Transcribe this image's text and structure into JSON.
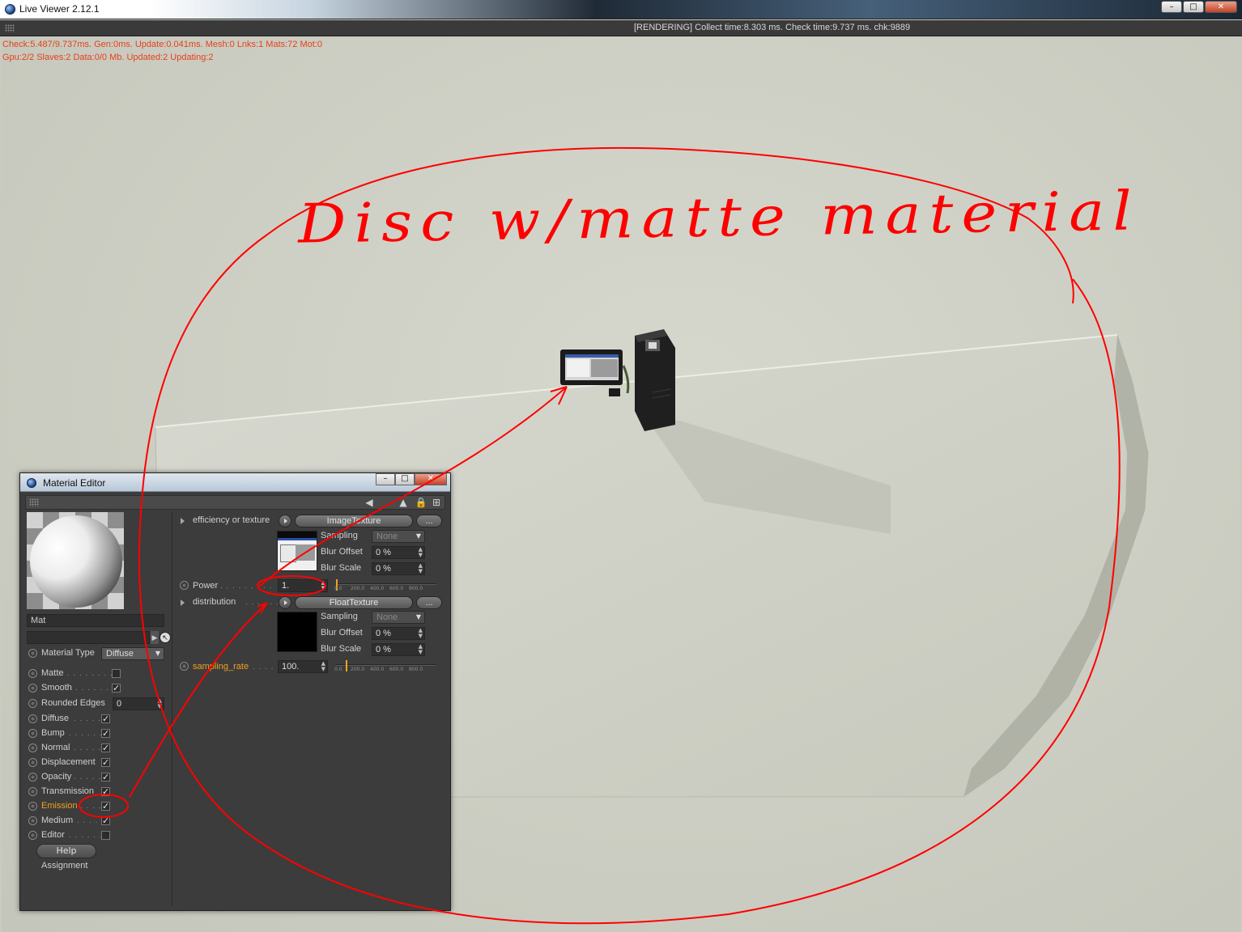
{
  "app": {
    "title": "Live Viewer 2.12.1",
    "window_controls": [
      "–",
      "□",
      "✕"
    ],
    "status_text": "[RENDERING] Collect time:8.303 ms.  Check time:9.737 ms.  chk:9889",
    "stats_line1": "Check:5.487/9.737ms. Gen:0ms. Update:0.041ms. Mesh:0 Lnks:1 Mats:72 Mot:0",
    "stats_line2": "Gpu:2/2 Slaves:2  Data:0/0 Mb.   Updated:2 Updating:2"
  },
  "annotation": {
    "text": "Disc w/matte material",
    "color": "#ff0000"
  },
  "material_editor": {
    "title": "Material Editor",
    "window_controls": [
      "–",
      "□",
      "✕"
    ],
    "toolbar_icons": [
      "arrow-left-icon",
      "arrow-up-icon",
      "lock-icon",
      "plus-icon"
    ],
    "name": "Mat",
    "link_value": "",
    "material_type_label": "Material Type",
    "material_type_value": "Diffuse",
    "channels": [
      {
        "label": "Matte",
        "dots": ". . . . . . . . .",
        "checked": false
      },
      {
        "label": "Smooth",
        "dots": ". . . . . . .",
        "checked": true
      },
      {
        "label": "Rounded Edges",
        "dots": "",
        "value": "0"
      },
      {
        "label": "Diffuse",
        "dots": ". . . . . .",
        "checked": true
      },
      {
        "label": "Bump",
        "dots": ". . . . . . .",
        "checked": true
      },
      {
        "label": "Normal",
        "dots": ". . . . .",
        "checked": true
      },
      {
        "label": "Displacement",
        "dots": "",
        "checked": true
      },
      {
        "label": "Opacity",
        "dots": ". . . . .",
        "checked": true
      },
      {
        "label": "Transmission",
        "dots": "",
        "checked": true
      },
      {
        "label": "Emission",
        "dots": ". . . .",
        "checked": true,
        "active": true
      },
      {
        "label": "Medium",
        "dots": ". . . .",
        "checked": true
      },
      {
        "label": "Editor",
        "dots": ". . . . . .",
        "checked": false
      }
    ],
    "help_label": "Help",
    "assignment_label": "Assignment",
    "params": {
      "efficiency_label": "efficiency or texture",
      "efficiency_button": "ImageTexture",
      "more_button": "...",
      "sampling_label": "Sampling",
      "sampling_value": "None",
      "blur_offset_label": "Blur Offset",
      "blur_offset_value": "0 %",
      "blur_scale_label": "Blur Scale",
      "blur_scale_value": "0 %",
      "power_label": "Power",
      "power_dots": ". . . . . . . . .",
      "power_value": "1.",
      "distribution_label": "distribution",
      "distribution_dots": ". . . . . .",
      "distribution_button": "FloatTexture",
      "sampling2_label": "Sampling",
      "sampling2_value": "None",
      "blur_offset2_label": "Blur Offset",
      "blur_offset2_value": "0 %",
      "blur_scale2_label": "Blur Scale",
      "blur_scale2_value": "0 %",
      "sampling_rate_label": "sampling_rate",
      "sampling_rate_dots": ". . . . .",
      "sampling_rate_value": "100.",
      "slider_ticks": [
        "0.0",
        "200.0",
        "400.0",
        "600.0",
        "800.0"
      ],
      "power_slider_fraction": 0.0,
      "sampling_rate_slider_fraction": 0.1
    }
  },
  "colors": {
    "accent_orange": "#f0a21e",
    "stats_red": "#e8401a",
    "annotation_red": "#ff0000"
  }
}
